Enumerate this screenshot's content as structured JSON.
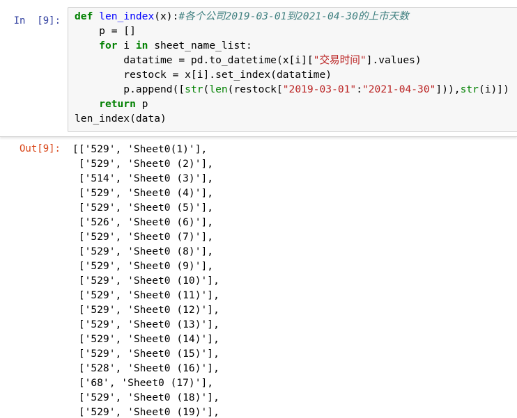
{
  "input_cell": {
    "prompt": "In  [9]:",
    "code": {
      "line1_kw": "def ",
      "line1_fn": "len_index",
      "line1_rest": "(x):",
      "line1_comment": "#各个公司2019-03-01到2021-04-30的上市天数",
      "line2": "    p = []",
      "line3_kw1": "for",
      "line3_mid": " i ",
      "line3_kw2": "in",
      "line3_rest": " sheet_name_list:",
      "line4_a": "        datatime = pd.to_datetime(x[i][",
      "line4_str": "\"交易时间\"",
      "line4_b": "].values)",
      "line5": "        restock = x[i].set_index(datatime)",
      "line6_a": "        p.append([",
      "line6_bi1": "str",
      "line6_b": "(",
      "line6_bi2": "len",
      "line6_c": "(restock[",
      "line6_str1": "\"2019-03-01\"",
      "line6_d": ":",
      "line6_str2": "\"2021-04-30\"",
      "line6_e": "])),",
      "line6_bi3": "str",
      "line6_f": "(i)])",
      "line7_kw": "return",
      "line7_rest": " p",
      "line8": "len_index(data)"
    }
  },
  "output_cell": {
    "prompt": "Out[9]:",
    "lines": [
      "[['529', 'Sheet0(1)'],",
      " ['529', 'Sheet0 (2)'],",
      " ['514', 'Sheet0 (3)'],",
      " ['529', 'Sheet0 (4)'],",
      " ['529', 'Sheet0 (5)'],",
      " ['526', 'Sheet0 (6)'],",
      " ['529', 'Sheet0 (7)'],",
      " ['529', 'Sheet0 (8)'],",
      " ['529', 'Sheet0 (9)'],",
      " ['529', 'Sheet0 (10)'],",
      " ['529', 'Sheet0 (11)'],",
      " ['529', 'Sheet0 (12)'],",
      " ['529', 'Sheet0 (13)'],",
      " ['529', 'Sheet0 (14)'],",
      " ['529', 'Sheet0 (15)'],",
      " ['528', 'Sheet0 (16)'],",
      " ['68', 'Sheet0 (17)'],",
      " ['529', 'Sheet0 (18)'],",
      " ['529', 'Sheet0 (19)'],"
    ]
  },
  "colors": {
    "in_prompt": "#303f9f",
    "out_prompt": "#d84315",
    "keyword": "#008000",
    "function_name": "#0000ff",
    "comment": "#408080",
    "string": "#ba2121"
  }
}
